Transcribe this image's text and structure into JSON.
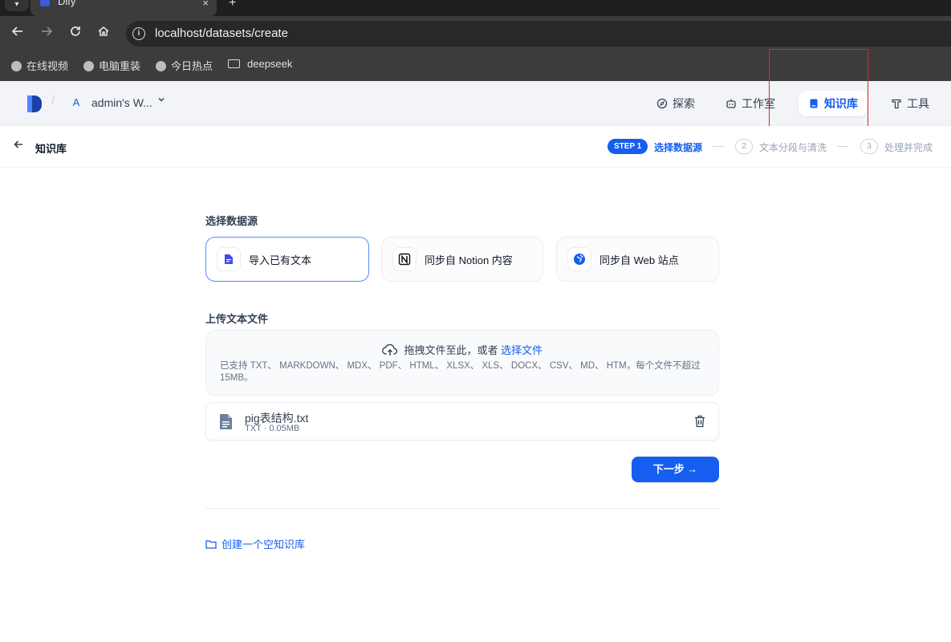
{
  "browser": {
    "tab_title": "Dify",
    "tab_close": "×",
    "new_tab": "+",
    "url": "localhost/datasets/create",
    "bookmarks": [
      {
        "label": "在线视频",
        "icon": "globe-icon"
      },
      {
        "label": "电脑重装",
        "icon": "globe-icon"
      },
      {
        "label": "今日热点",
        "icon": "globe-icon"
      },
      {
        "label": "deepseek",
        "icon": "folder-icon"
      }
    ]
  },
  "header": {
    "workspace_initial": "A",
    "workspace_name": "admin's W...",
    "nav": [
      {
        "label": "探索",
        "icon": "compass-icon"
      },
      {
        "label": "工作室",
        "icon": "robot-icon"
      },
      {
        "label": "知识库",
        "icon": "book-icon",
        "active": true
      },
      {
        "label": "工具",
        "icon": "hammer-icon"
      }
    ]
  },
  "subheader": {
    "back_label": "知识库",
    "steps": [
      {
        "badge": "STEP 1",
        "label": "选择数据源",
        "active": true
      },
      {
        "badge": "2",
        "label": "文本分段与清洗"
      },
      {
        "badge": "3",
        "label": "处理并完成"
      }
    ]
  },
  "main": {
    "source_title": "选择数据源",
    "sources": [
      {
        "label": "导入已有文本",
        "icon": "document-icon",
        "selected": true
      },
      {
        "label": "同步自 Notion 内容",
        "icon": "notion-icon"
      },
      {
        "label": "同步自 Web 站点",
        "icon": "web-icon"
      }
    ],
    "upload_title": "上传文本文件",
    "dropzone": {
      "prompt": "拖拽文件至此，或者",
      "link": "选择文件",
      "formats": "已支持 TXT、 MARKDOWN、 MDX、 PDF、 HTML、 XLSX、 XLS、 DOCX、 CSV、 MD、 HTM，每个文件不超过 15MB。"
    },
    "file": {
      "name": "pig表结构.txt",
      "meta": "TXT · 0.05MB"
    },
    "next_button": "下一步 →",
    "create_empty": "创建一个空知识库"
  },
  "colors": {
    "accent": "#155eef",
    "highlight_box": "#e02424"
  }
}
